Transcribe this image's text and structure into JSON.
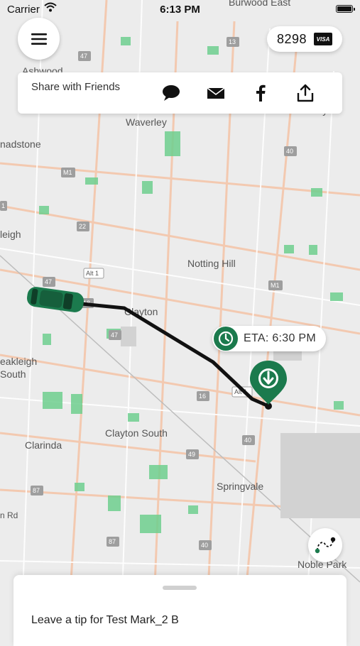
{
  "status_bar": {
    "carrier": "Carrier",
    "time": "6:13 PM"
  },
  "payment": {
    "amount": "8298",
    "card_brand": "VISA"
  },
  "share": {
    "title": "Share with Friends",
    "icons": [
      "chat-bubble-icon",
      "mail-icon",
      "facebook-icon",
      "share-upload-icon"
    ]
  },
  "eta": {
    "label": "ETA: 6:30 PM"
  },
  "bottom_sheet": {
    "tip_text": "Leave a tip for Test Mark_2 B"
  },
  "map": {
    "places": [
      "Burwood East",
      "Waverley",
      "Glen Waverley",
      "nadstone",
      "Notting Hill",
      "Clayton",
      "eakleigh",
      "South",
      "Clayton South",
      "Clarinda",
      "Springvale",
      "Noble Park",
      "Ashwood",
      "leigh",
      "n Rd"
    ],
    "road_shields": [
      "13",
      "47",
      "40",
      "M1",
      "22",
      "Alt 1",
      "18",
      "M1",
      "47",
      "40",
      "16",
      "Alt 1",
      "49",
      "40",
      "87",
      "87",
      "1",
      "1"
    ],
    "colors": {
      "route": "#111111",
      "brand_green": "#1b7a4d",
      "park": "#6fcf8f",
      "road": "#f3c9b0"
    }
  }
}
